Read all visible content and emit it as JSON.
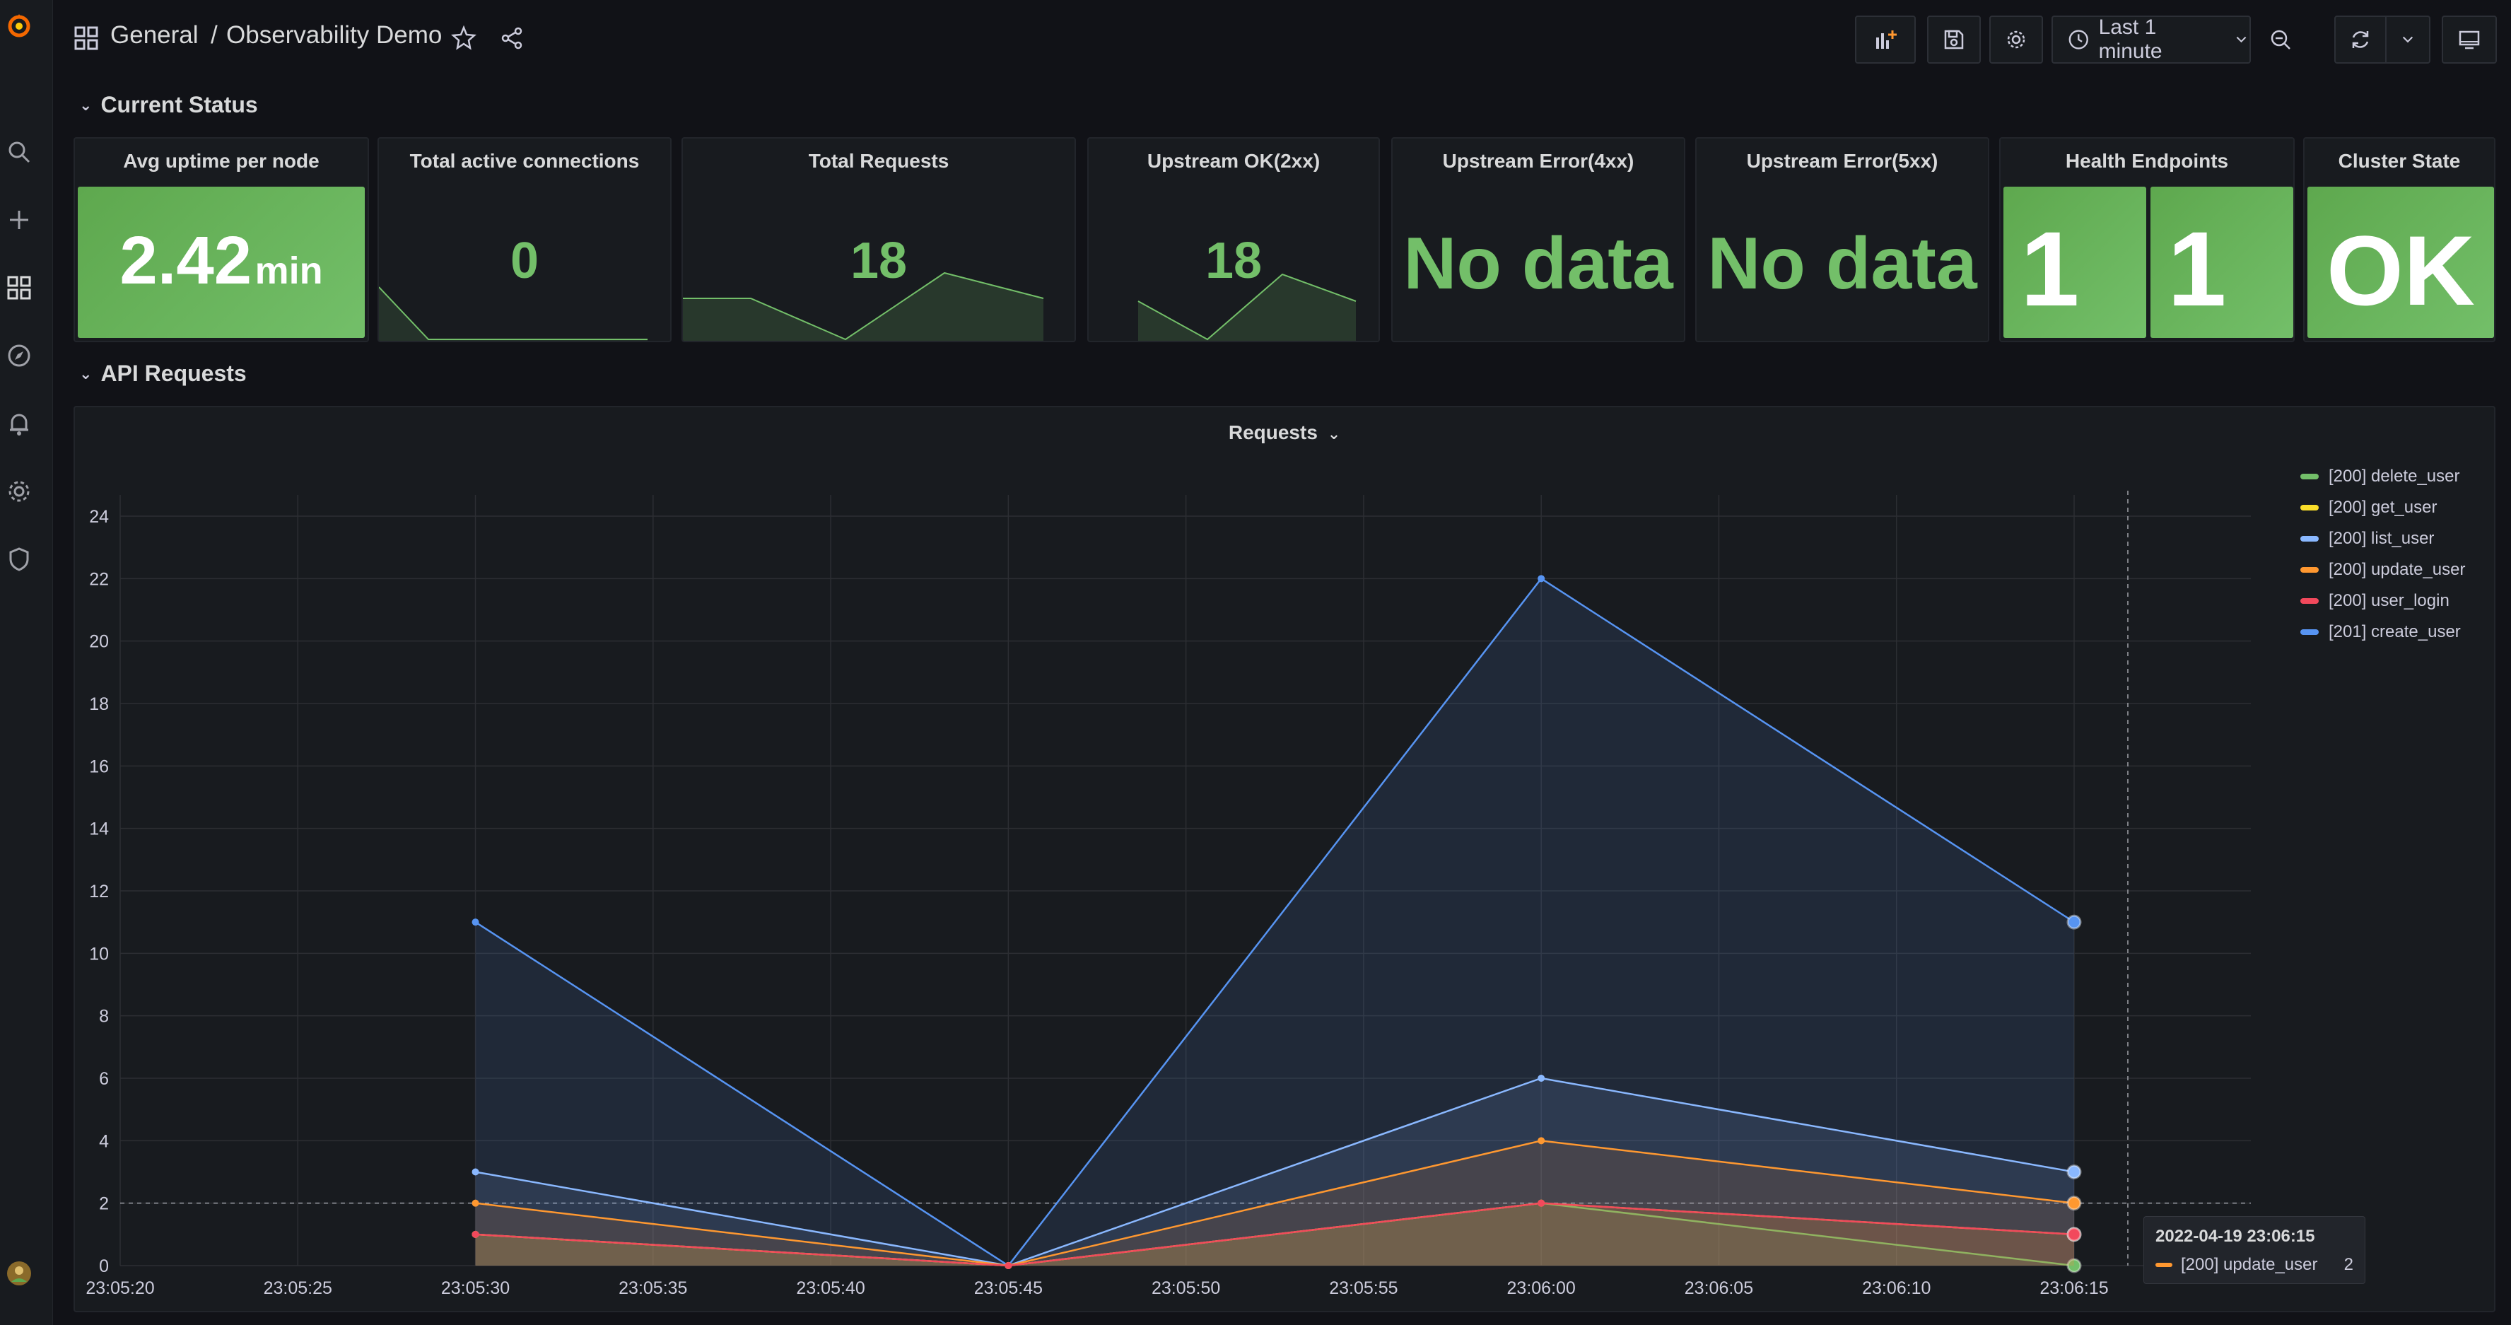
{
  "breadcrumb": {
    "folder": "General",
    "separator": "/",
    "dashboard": "Observability Demo"
  },
  "toolbar": {
    "time_range": "Last 1 minute"
  },
  "rows": {
    "current_status": "Current Status",
    "api_requests": "API Requests"
  },
  "stats": {
    "uptime": {
      "title": "Avg uptime per node",
      "value": "2.42",
      "unit": "min"
    },
    "connections": {
      "title": "Total active connections",
      "value": "0"
    },
    "total_requests": {
      "title": "Total Requests",
      "value": "18"
    },
    "upstream_ok": {
      "title": "Upstream OK(2xx)",
      "value": "18"
    },
    "upstream_4xx": {
      "title": "Upstream Error(4xx)",
      "value": "No data"
    },
    "upstream_5xx": {
      "title": "Upstream Error(5xx)",
      "value": "No data"
    },
    "health": {
      "title": "Health Endpoints",
      "values": [
        "1",
        "1"
      ]
    },
    "cluster": {
      "title": "Cluster State",
      "value": "OK"
    }
  },
  "colors": {
    "green": "#73bf69",
    "yellow": "#fade2a",
    "light_blue": "#8ab8ff",
    "orange": "#ff9830",
    "red": "#f2495c",
    "blue": "#5794f2"
  },
  "requests_panel": {
    "title": "Requests",
    "tooltip": {
      "time": "2022-04-19 23:06:15",
      "series": "[200] update_user",
      "value": "2"
    }
  },
  "chart_data": {
    "type": "area",
    "title": "Requests",
    "x": [
      "23:05:30",
      "23:05:45",
      "23:06:00",
      "23:06:15"
    ],
    "x_ticks": [
      "23:05:20",
      "23:05:25",
      "23:05:30",
      "23:05:35",
      "23:05:40",
      "23:05:45",
      "23:05:50",
      "23:05:55",
      "23:06:00",
      "23:06:05",
      "23:06:10",
      "23:06:15"
    ],
    "y_ticks": [
      "0",
      "2",
      "4",
      "6",
      "8",
      "10",
      "12",
      "14",
      "16",
      "18",
      "20",
      "22",
      "24"
    ],
    "ylim": [
      0,
      24
    ],
    "legend_position": "right",
    "grid": true,
    "series": [
      {
        "name": "[200] delete_user",
        "color": "#73bf69",
        "values": [
          1,
          0,
          2,
          0
        ]
      },
      {
        "name": "[200] get_user",
        "color": "#fade2a",
        "values": [
          1,
          0,
          2,
          1
        ]
      },
      {
        "name": "[200] list_user",
        "color": "#8ab8ff",
        "values": [
          3,
          0,
          6,
          3
        ]
      },
      {
        "name": "[200] update_user",
        "color": "#ff9830",
        "values": [
          2,
          0,
          4,
          2
        ]
      },
      {
        "name": "[200] user_login",
        "color": "#f2495c",
        "values": [
          1,
          0,
          2,
          1
        ]
      },
      {
        "name": "[201] create_user",
        "color": "#5794f2",
        "values": [
          11,
          0,
          22,
          11
        ]
      }
    ]
  }
}
